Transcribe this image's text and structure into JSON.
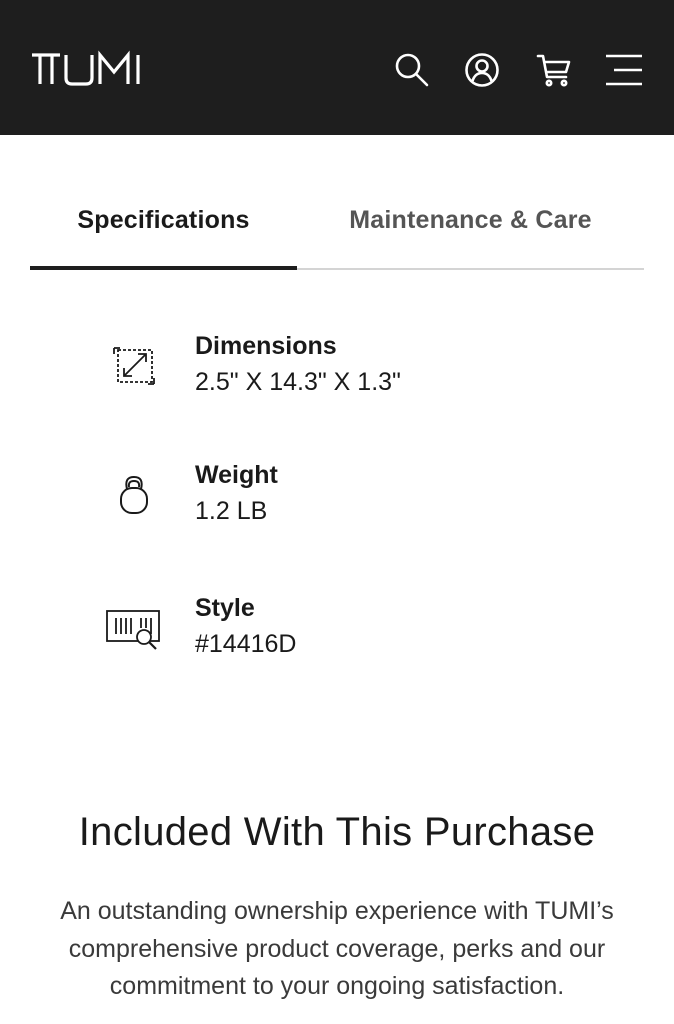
{
  "header": {
    "brand": "TUMI",
    "icons": [
      "search-icon",
      "account-icon",
      "cart-icon",
      "menu-icon"
    ],
    "background": "#1e1e1e"
  },
  "tabs": [
    {
      "label": "Specifications",
      "active": true
    },
    {
      "label": "Maintenance & Care",
      "active": false
    }
  ],
  "specs": [
    {
      "icon": "dimensions-icon",
      "label": "Dimensions",
      "value": "2.5\" X 14.3\" X 1.3\""
    },
    {
      "icon": "weight-icon",
      "label": "Weight",
      "value": "1.2 LB"
    },
    {
      "icon": "style-barcode-icon",
      "label": "Style",
      "value": "#14416D"
    }
  ],
  "included": {
    "title": "Included With This Purchase",
    "text": "An outstanding ownership experience with TUMI’s comprehensive product coverage, perks and our commitment to your ongoing satisfaction."
  }
}
